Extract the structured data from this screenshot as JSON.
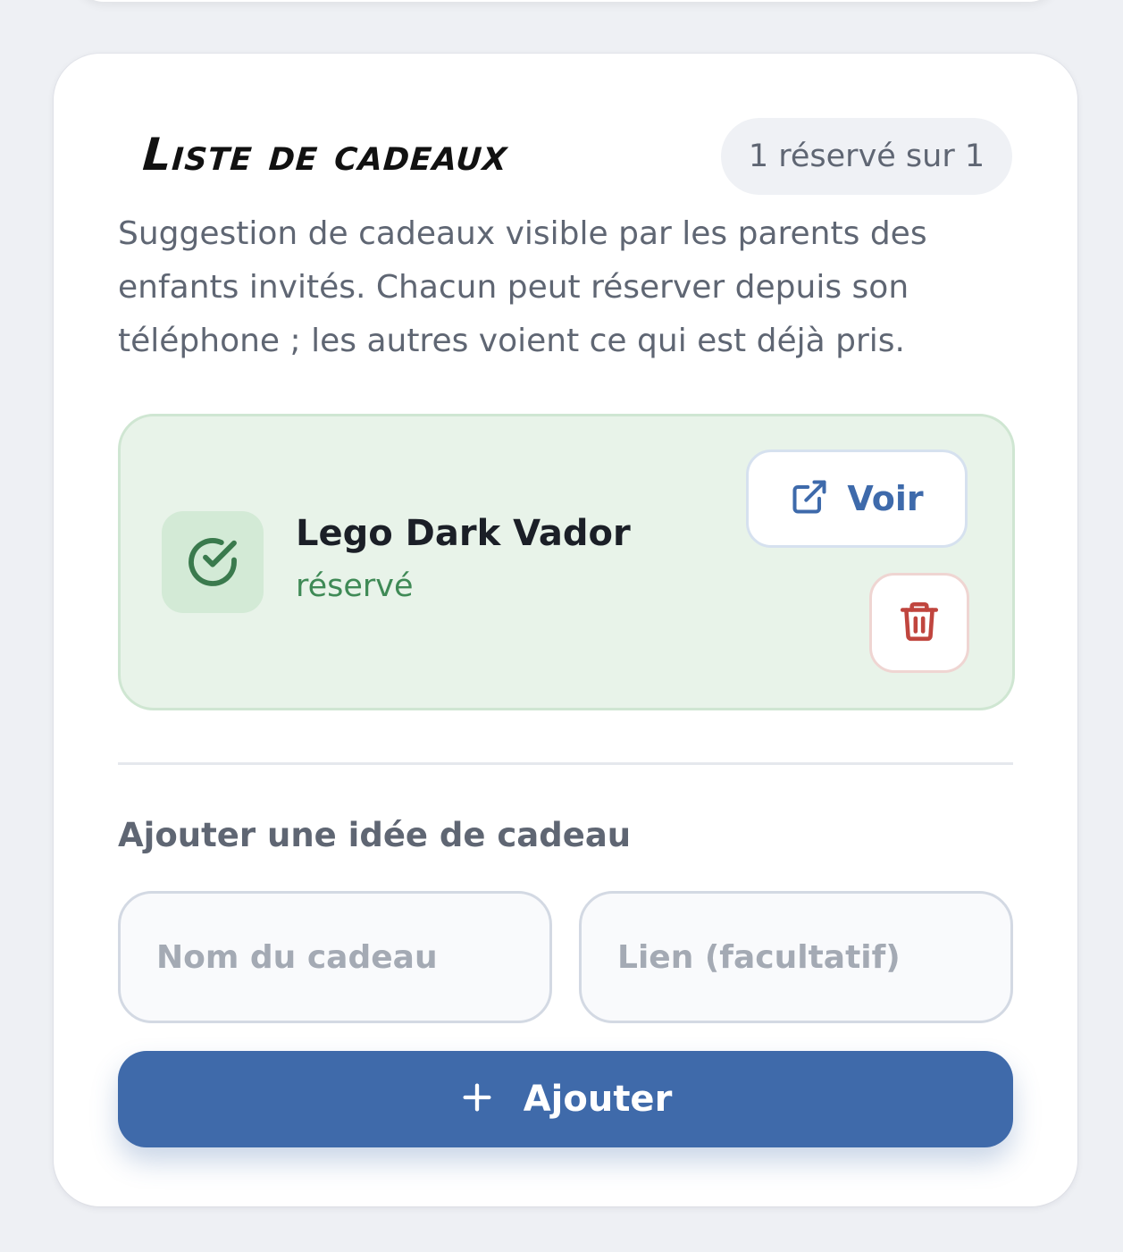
{
  "gift_list": {
    "title": "Liste de cadeaux",
    "counter_badge": "1 réservé sur 1",
    "description": "Suggestion de cadeaux visible par les parents des enfants invités. Chacun peut réserver depuis son téléphone ; les autres voient ce qui est déjà pris.",
    "items": [
      {
        "name": "Lego Dark Vador",
        "status": "réservé",
        "status_icon": "check-circle-icon",
        "view_button": {
          "label": "Voir",
          "icon": "external-link-icon"
        },
        "delete_button": {
          "icon": "trash-icon"
        }
      }
    ]
  },
  "add_form": {
    "heading": "Ajouter une idée de cadeau",
    "name_input": {
      "placeholder": "Nom du cadeau",
      "value": ""
    },
    "link_input": {
      "placeholder": "Lien (facultatif)",
      "value": ""
    },
    "submit_button": {
      "label": "Ajouter",
      "icon": "plus-icon"
    }
  },
  "colors": {
    "accent": "#3f6aaa",
    "reserved_bg": "#e8f3e9",
    "reserved_text": "#3f8a56",
    "danger": "#c0453e"
  }
}
